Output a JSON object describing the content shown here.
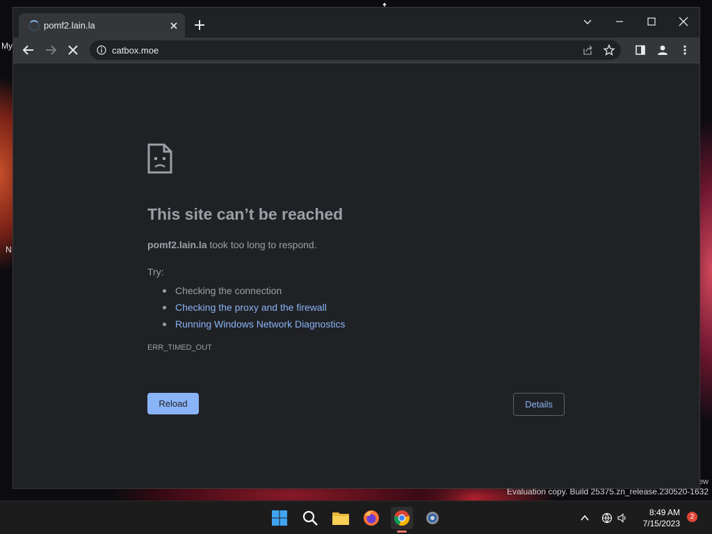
{
  "desktop": {
    "labels": [
      "My",
      "N"
    ],
    "watermark_line1": "ew",
    "watermark": "Evaluation copy. Build 25375.zn_release.230520-1632"
  },
  "browser": {
    "tab": {
      "title": "pomf2.lain.la",
      "loading": true
    },
    "omnibox": {
      "url": "catbox.moe"
    },
    "icons": {
      "back": "arrow-left-icon",
      "forward": "arrow-right-icon",
      "stop": "close-icon",
      "info": "info-icon",
      "share": "share-icon",
      "bookmark": "star-icon",
      "side_panel": "side-panel-icon",
      "profile": "profile-icon",
      "menu": "kebab-menu-icon"
    }
  },
  "error_page": {
    "title": "This site can’t be reached",
    "host": "pomf2.lain.la",
    "description_suffix": " took too long to respond.",
    "try_label": "Try:",
    "suggestions": [
      {
        "text": "Checking the connection",
        "is_link": false
      },
      {
        "text": "Checking the proxy and the firewall",
        "is_link": true
      },
      {
        "text": "Running Windows Network Diagnostics",
        "is_link": true
      }
    ],
    "error_code": "ERR_TIMED_OUT",
    "reload_label": "Reload",
    "details_label": "Details"
  },
  "taskbar": {
    "apps": [
      "start-icon",
      "search-icon",
      "file-explorer-icon",
      "firefox-icon",
      "chrome-icon",
      "settings-icon"
    ],
    "active_app": "chrome-icon",
    "time": "8:49 AM",
    "date": "7/15/2023",
    "notification_count": "2"
  },
  "colors": {
    "page_bg": "#202124",
    "link": "#8ab4f8",
    "muted_text": "#9aa0a6",
    "toolbar": "#35363a"
  }
}
